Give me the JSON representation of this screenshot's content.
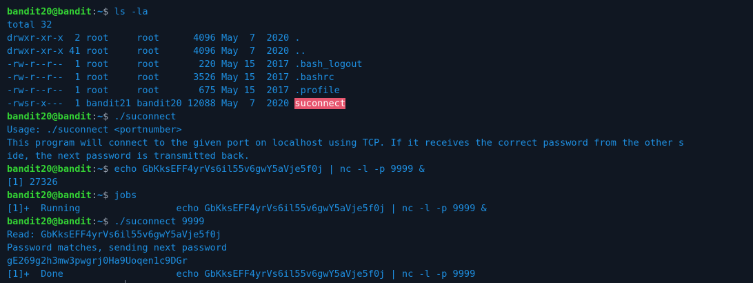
{
  "window": {
    "prompt_user": "bandit20@bandit",
    "prompt_sep": ":",
    "prompt_dir": "~",
    "prompt_char": "$ "
  },
  "colors": {
    "background": "#101722",
    "prompt_user": "#34d434",
    "text": "#1e8fe1",
    "highlight_bg": "#e8566f",
    "highlight_fg": "#ffffff"
  },
  "lines": [
    {
      "type": "prompt",
      "cmd": "ls -la"
    },
    {
      "type": "out",
      "text": "total 32"
    },
    {
      "type": "out",
      "text": "drwxr-xr-x  2 root     root      4096 May  7  2020 ."
    },
    {
      "type": "out",
      "text": "drwxr-xr-x 41 root     root      4096 May  7  2020 .."
    },
    {
      "type": "out",
      "text": "-rw-r--r--  1 root     root       220 May 15  2017 .bash_logout"
    },
    {
      "type": "out",
      "text": "-rw-r--r--  1 root     root      3526 May 15  2017 .bashrc"
    },
    {
      "type": "out",
      "text": "-rw-r--r--  1 root     root       675 May 15  2017 .profile"
    },
    {
      "type": "out_hl",
      "text": "-rwsr-x---  1 bandit21 bandit20 12088 May  7  2020 ",
      "hl": "suconnect"
    },
    {
      "type": "prompt",
      "cmd": "./suconnect"
    },
    {
      "type": "out",
      "text": "Usage: ./suconnect <portnumber>"
    },
    {
      "type": "out",
      "text": "This program will connect to the given port on localhost using TCP. If it receives the correct password from the other s"
    },
    {
      "type": "out",
      "text": "ide, the next password is transmitted back."
    },
    {
      "type": "prompt",
      "cmd": "echo GbKksEFF4yrVs6il55v6gwY5aVje5f0j | nc -l -p 9999 &"
    },
    {
      "type": "out",
      "text": "[1] 27326"
    },
    {
      "type": "prompt",
      "cmd": "jobs"
    },
    {
      "type": "out",
      "text": "[1]+  Running                 echo GbKksEFF4yrVs6il55v6gwY5aVje5f0j | nc -l -p 9999 &"
    },
    {
      "type": "prompt",
      "cmd": "./suconnect 9999"
    },
    {
      "type": "out",
      "text": "Read: GbKksEFF4yrVs6il55v6gwY5aVje5f0j"
    },
    {
      "type": "out",
      "text": "Password matches, sending next password"
    },
    {
      "type": "out",
      "text": "gE269g2h3mw3pwgrj0Ha9Uoqen1c9DGr"
    },
    {
      "type": "out",
      "text": "[1]+  Done                    echo GbKksEFF4yrVs6il55v6gwY5aVje5f0j | nc -l -p 9999"
    }
  ]
}
